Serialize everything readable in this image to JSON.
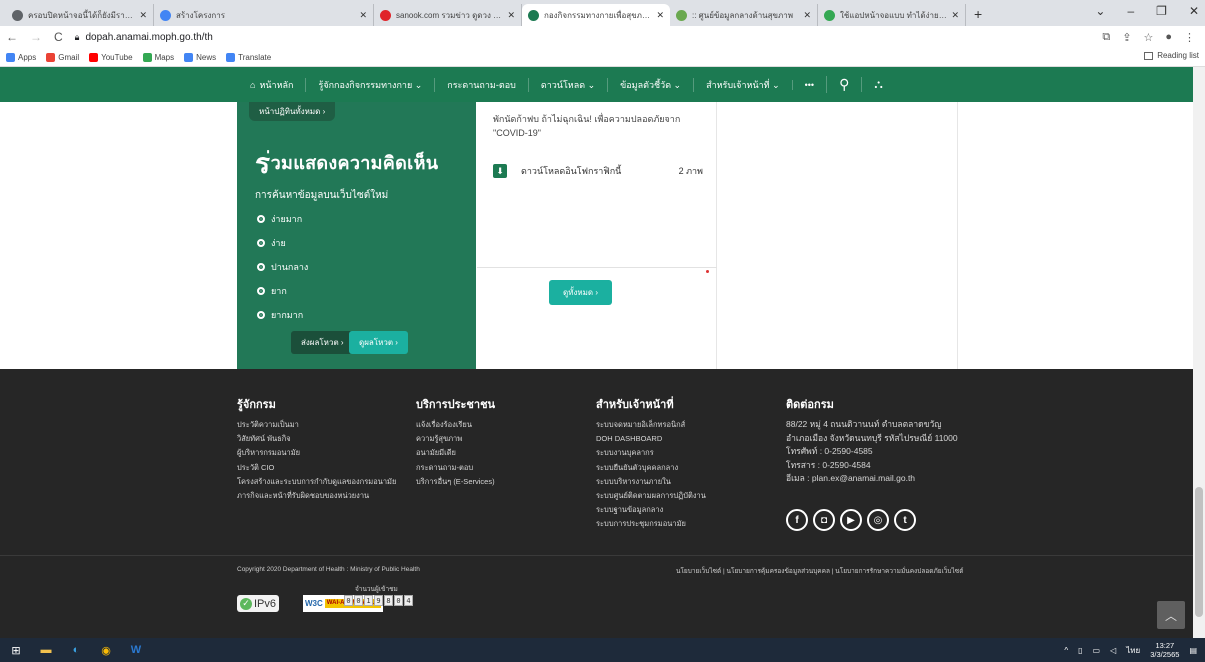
{
  "browser": {
    "tabs": [
      {
        "title": "ครอบปิดหน้าจอนี้ได้ก็ยังมีรายการ Inte",
        "fav": "#5f6368",
        "wide": false,
        "active": false
      },
      {
        "title": "สร้างโครงการ",
        "fav": "#4285f4",
        "wide": true,
        "active": false
      },
      {
        "title": "sanook.com รวมข่าว ดูดวง ทาย ผล",
        "fav": "#e0242a",
        "wide": false,
        "active": false
      },
      {
        "title": "กองกิจกรรมทางกายเพื่อสุขภาพ | หน้า",
        "fav": "#1c7a52",
        "wide": false,
        "active": true
      },
      {
        "title": ":: ศูนย์ข้อมูลกลางด้านสุขภาพ",
        "fav": "#6aa84f",
        "wide": false,
        "active": false
      },
      {
        "title": "ใช้แอปหน้าจอแบบ ทำได้ง่าย ไม่ต้องใ",
        "fav": "#34a853",
        "wide": false,
        "active": false
      }
    ],
    "new_tab": "+",
    "url": "dopah.anamai.moph.go.th/th",
    "bookmarks": [
      {
        "label": "Apps",
        "color": "#4285f4"
      },
      {
        "label": "Gmail",
        "color": "#ea4335"
      },
      {
        "label": "YouTube",
        "color": "#ff0000"
      },
      {
        "label": "Maps",
        "color": "#34a853"
      },
      {
        "label": "News",
        "color": "#4285f4"
      },
      {
        "label": "Translate",
        "color": "#4285f4"
      }
    ],
    "reading_list": "Reading list"
  },
  "nav": {
    "home": "หน้าหลัก",
    "items": [
      "รู้จักกองกิจกรรมทางกาย ⌄",
      "กระดานถาม-ตอบ",
      "ดาวน์โหลด ⌄",
      "ข้อมูลตัวชี้วัด ⌄",
      "สำหรับเจ้าหน้าที่ ⌄",
      "•••"
    ]
  },
  "survey": {
    "more_activities": "หน้าปฏิทินทั้งหมด ›",
    "title_first": "ร",
    "title_rest": "่วมแสดงความคิดเห็น",
    "question": "การค้นหาข้อมูลบนเว็บไซต์ใหม่",
    "options": [
      "ง่ายมาก",
      "ง่าย",
      "ปานกลาง",
      "ยาก",
      "ยากมาก"
    ],
    "vote": "ส่งผลโหวต ›",
    "results": "ดูผลโหวต ›"
  },
  "news": {
    "text": "พักนัดก้าฟบ ถ้าไม่ฉุกเฉิน! เพื่อความปลอดภัยจาก \"COVID-19\"",
    "download_label": "ดาวน์โหลดอินโฟกราฟิกนี้",
    "download_count": "2 ภาพ",
    "more": "ดูทั้งหมด ›"
  },
  "footer": {
    "col1": {
      "title": "รู้จักกรม",
      "items": [
        "ประวัติความเป็นมา",
        "วิสัยทัศน์ พันธกิจ",
        "ผู้บริหารกรมอนามัย",
        "ประวัติ CIO",
        "โครงสร้างและระบบการกำกับดูแลของกรมอนามัย",
        "ภารกิจและหน้าที่รับผิดชอบของหน่วยงาน"
      ]
    },
    "col2": {
      "title": "บริการประชาชน",
      "items": [
        "แจ้งเรื่องร้องเรียน",
        "ความรู้สุขภาพ",
        "อนามัยมีเดีย",
        "กระดานถาม-ตอบ",
        "บริการอื่นๆ (E-Services)"
      ]
    },
    "col3": {
      "title": "สำหรับเจ้าหน้าที่",
      "items": [
        "ระบบจดหมายอิเล็กทรอนิกส์",
        "DOH DASHBOARD",
        "ระบบงานบุคลากร",
        "ระบบยืนยันตัวบุคคลกลาง",
        "ระบบบริหารงานภายใน",
        "ระบบศูนย์ติดตามผลการปฏิบัติงาน",
        "ระบบฐานข้อมูลกลาง",
        "ระบบการประชุมกรมอนามัย"
      ]
    },
    "contact": {
      "title": "ติดต่อกรม",
      "items": [
        "88/22 หมู่ 4 ถนนติวานนท์ ตำบลตลาดขวัญ",
        "อำเภอเมือง จังหวัดนนทบุรี รหัสไปรษณีย์ 11000",
        "โทรศัพท์ : 0-2590-4585",
        "โทรสาร : 0-2590-4584",
        "อีเมล : plan.ex@anamai.mail.go.th"
      ]
    },
    "copyright": "Copyright 2020 Department of Health : Ministry of Public Health",
    "policy": "นโยบายเว็บไซต์ | นโยบายการคุ้มครองข้อมูลส่วนบุคคล | นโยบายการรักษาความมั่นคงปลอดภัยเว็บไซต์",
    "visitors_label": "จำนวนผู้เข้าชม",
    "visitor_digits": [
      "0",
      "0",
      "1",
      "9",
      "8",
      "0",
      "4"
    ],
    "ipv6": "IPv6",
    "w3c": "W3C",
    "wcag": "WAI-AA WCAG 1.0"
  },
  "taskbar": {
    "time": "13:27",
    "date": "3/3/2565",
    "lang": "ไทย"
  }
}
